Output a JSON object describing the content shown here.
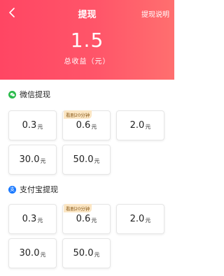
{
  "header": {
    "title": "提现",
    "explain_label": "提现说明",
    "amount": "1.5",
    "amount_label": "总收益（元）"
  },
  "colors": {
    "header_start": "#ff4663",
    "header_end": "#ff6f6f",
    "wechat": "#2bbb4c",
    "alipay": "#1677ff",
    "badge_bg": "#fbe6c4"
  },
  "wechat": {
    "title": "微信提现",
    "icon": "wechat-icon",
    "options": [
      {
        "value": "0.3",
        "unit": "元",
        "badge": ""
      },
      {
        "value": "0.6",
        "unit": "元",
        "badge": "看剧20分钟"
      },
      {
        "value": "2.0",
        "unit": "元",
        "badge": ""
      },
      {
        "value": "30.0",
        "unit": "元",
        "badge": ""
      },
      {
        "value": "50.0",
        "unit": "元",
        "badge": ""
      }
    ]
  },
  "alipay": {
    "title": "支付宝提现",
    "icon": "alipay-icon",
    "icon_glyph": "支",
    "options": [
      {
        "value": "0.3",
        "unit": "元",
        "badge": ""
      },
      {
        "value": "0.6",
        "unit": "元",
        "badge": "看剧20分钟"
      },
      {
        "value": "2.0",
        "unit": "元",
        "badge": ""
      },
      {
        "value": "30.0",
        "unit": "元",
        "badge": ""
      },
      {
        "value": "50.0",
        "unit": "元",
        "badge": ""
      }
    ]
  }
}
